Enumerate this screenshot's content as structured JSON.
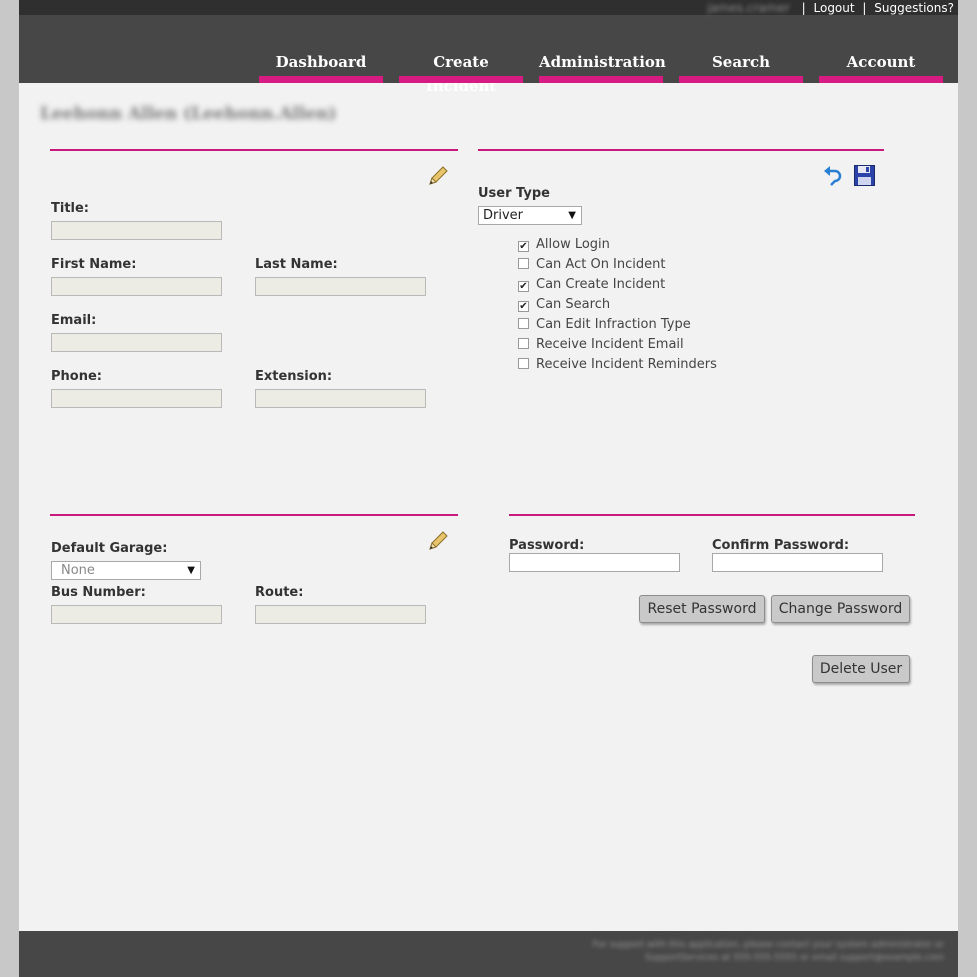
{
  "header": {
    "user_link": "james.cramer",
    "logout_label": "Logout",
    "suggestions_label": "Suggestions?",
    "separator": "|"
  },
  "nav": {
    "items": [
      {
        "label": "Dashboard"
      },
      {
        "label": "Create Incident"
      },
      {
        "label": "Administration"
      },
      {
        "label": "Search"
      },
      {
        "label": "Account"
      }
    ]
  },
  "user_heading": "Leehonn Allen (Leehonn.Allen)",
  "profile": {
    "title_label": "Title:",
    "title_value": "",
    "first_name_label": "First Name:",
    "first_name_value": "",
    "last_name_label": "Last Name:",
    "last_name_value": "",
    "email_label": "Email:",
    "email_value": "",
    "phone_label": "Phone:",
    "phone_value": "",
    "extension_label": "Extension:",
    "extension_value": ""
  },
  "permissions": {
    "user_type_label": "User Type",
    "user_type_value": "Driver",
    "options": [
      {
        "label": "Allow Login",
        "checked": true
      },
      {
        "label": "Can Act On Incident",
        "checked": false
      },
      {
        "label": "Can Create Incident",
        "checked": true
      },
      {
        "label": "Can Search",
        "checked": true
      },
      {
        "label": "Can Edit Infraction Type",
        "checked": false
      },
      {
        "label": "Receive Incident Email",
        "checked": false
      },
      {
        "label": "Receive Incident Reminders",
        "checked": false
      }
    ]
  },
  "garage": {
    "default_garage_label": "Default Garage:",
    "default_garage_value": "None",
    "bus_number_label": "Bus Number:",
    "bus_number_value": "",
    "route_label": "Route:",
    "route_value": ""
  },
  "password": {
    "password_label": "Password:",
    "confirm_label": "Confirm Password:",
    "reset_button": "Reset Password",
    "change_button": "Change Password"
  },
  "delete_button": "Delete User",
  "footer": {
    "text": "For support with this application, please contact your system administrator or SupportServices at 555-555-5555 or email support@example.com"
  },
  "colors": {
    "accent": "#d61b82",
    "header_bg": "#474747",
    "page_bg": "#f2f2f2"
  }
}
